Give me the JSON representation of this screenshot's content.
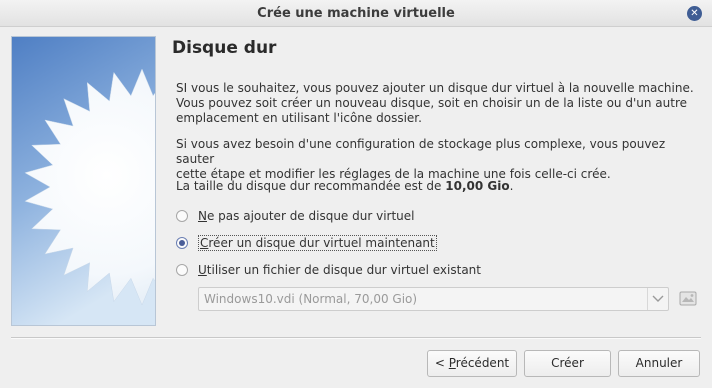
{
  "window": {
    "title": "Crée une machine virtuelle",
    "close_icon": "close-icon"
  },
  "page": {
    "heading": "Disque dur",
    "para1_line1": "SI vous le souhaitez, vous pouvez ajouter un disque dur virtuel à la nouvelle machine.",
    "para1_line2": "Vous pouvez soit créer un nouveau disque, soit en choisir un de la liste ou d'un autre",
    "para1_line3": "emplacement en utilisant l'icône dossier.",
    "para2_line1": "Si vous avez besoin d'une configuration de stockage plus complexe, vous pouvez sauter",
    "para2_line2": "cette étape et modifier les réglages de la machine une fois celle-ci crée.",
    "recommend_prefix": "La taille du disque dur recommandée est de ",
    "recommend_size": "10,00 Gio",
    "recommend_suffix": "."
  },
  "options": {
    "no_disk": {
      "mnemonic": "N",
      "rest": "e pas ajouter de disque dur virtuel",
      "checked": false
    },
    "create_disk": {
      "mnemonic": "C",
      "rest": "réer un disque dur virtuel maintenant",
      "checked": true
    },
    "existing_disk": {
      "mnemonic": "U",
      "rest": "tiliser un fichier de disque dur virtuel existant",
      "checked": false
    }
  },
  "existing_file": {
    "selected": "Windows10.vdi (Normal, 70,00 Gio)",
    "dropdown_icon": "chevron-down-icon",
    "folder_icon": "folder-icon"
  },
  "buttons": {
    "back_prefix": "< ",
    "back_mnemonic": "P",
    "back_rest": "récédent",
    "create": "Créer",
    "cancel": "Annuler"
  },
  "colors": {
    "accent": "#4a5e98",
    "banner_sky_top": "#5b88c8",
    "banner_sky_bottom": "#bcd5ee"
  }
}
